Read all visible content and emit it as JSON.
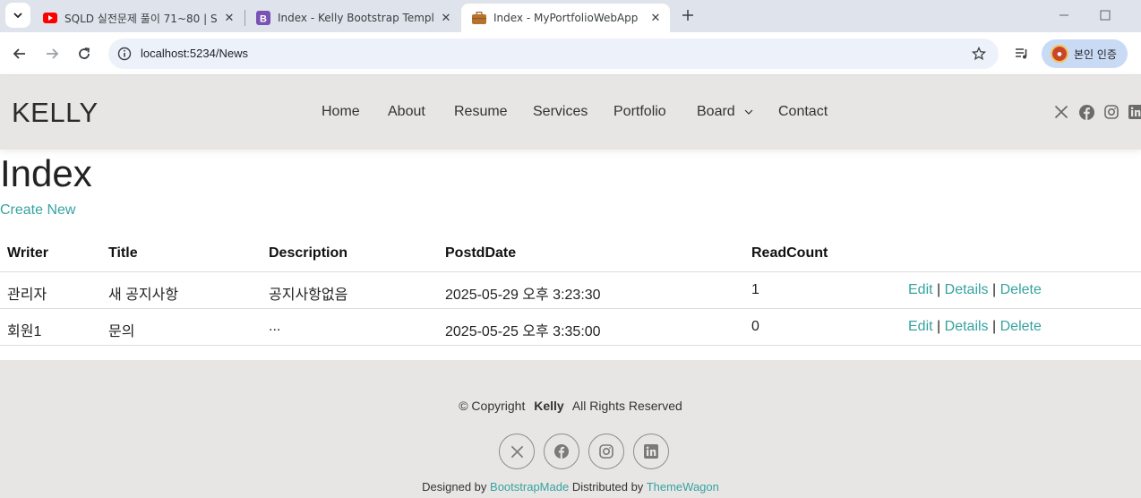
{
  "browser": {
    "tabs": [
      {
        "title": "SQLD 실전문제 풀이 71~80 | S",
        "favicon": "youtube-icon",
        "active": false
      },
      {
        "title": "Index - Kelly Bootstrap Templa",
        "favicon": "bootstrap-icon",
        "active": false
      },
      {
        "title": "Index - MyPortfolioWebApp",
        "favicon": "briefcase-icon",
        "active": true
      }
    ],
    "url": "localhost:5234/News",
    "profile_label": "본인 인증"
  },
  "site": {
    "logo": "KELLY",
    "nav": [
      "Home",
      "About",
      "Resume",
      "Services",
      "Portfolio",
      "Board",
      "Contact"
    ],
    "social_icons": [
      "x-icon",
      "facebook-icon",
      "instagram-icon",
      "linkedin-icon"
    ]
  },
  "main": {
    "title": "Index",
    "create_new": "Create New",
    "table": {
      "headers": [
        "Writer",
        "Title",
        "Description",
        "PostdDate",
        "ReadCount"
      ],
      "rows": [
        {
          "writer": "관리자",
          "title": "새 공지사항",
          "description": "공지사항없음",
          "date": "2025-05-29 오후 3:23:30",
          "read_count": "1"
        },
        {
          "writer": "회원1",
          "title": "문의",
          "description": "...",
          "date": "2025-05-25 오후 3:35:00",
          "read_count": "0"
        }
      ],
      "actions": {
        "edit": "Edit",
        "details": "Details",
        "delete": "Delete",
        "separator": "|"
      }
    }
  },
  "footer": {
    "copyright_prefix": "© Copyright",
    "brand": "Kelly",
    "copyright_suffix": "All Rights Reserved",
    "designed_by": "Designed by",
    "designer": "BootstrapMade",
    "distributed_by": "Distributed by",
    "distributor": "ThemeWagon"
  },
  "colors": {
    "accent": "#36a3a0",
    "header_bg": "#e7e6e4",
    "tabstrip_bg": "#dfe3eb",
    "omnibox_bg": "#edf2fa"
  }
}
